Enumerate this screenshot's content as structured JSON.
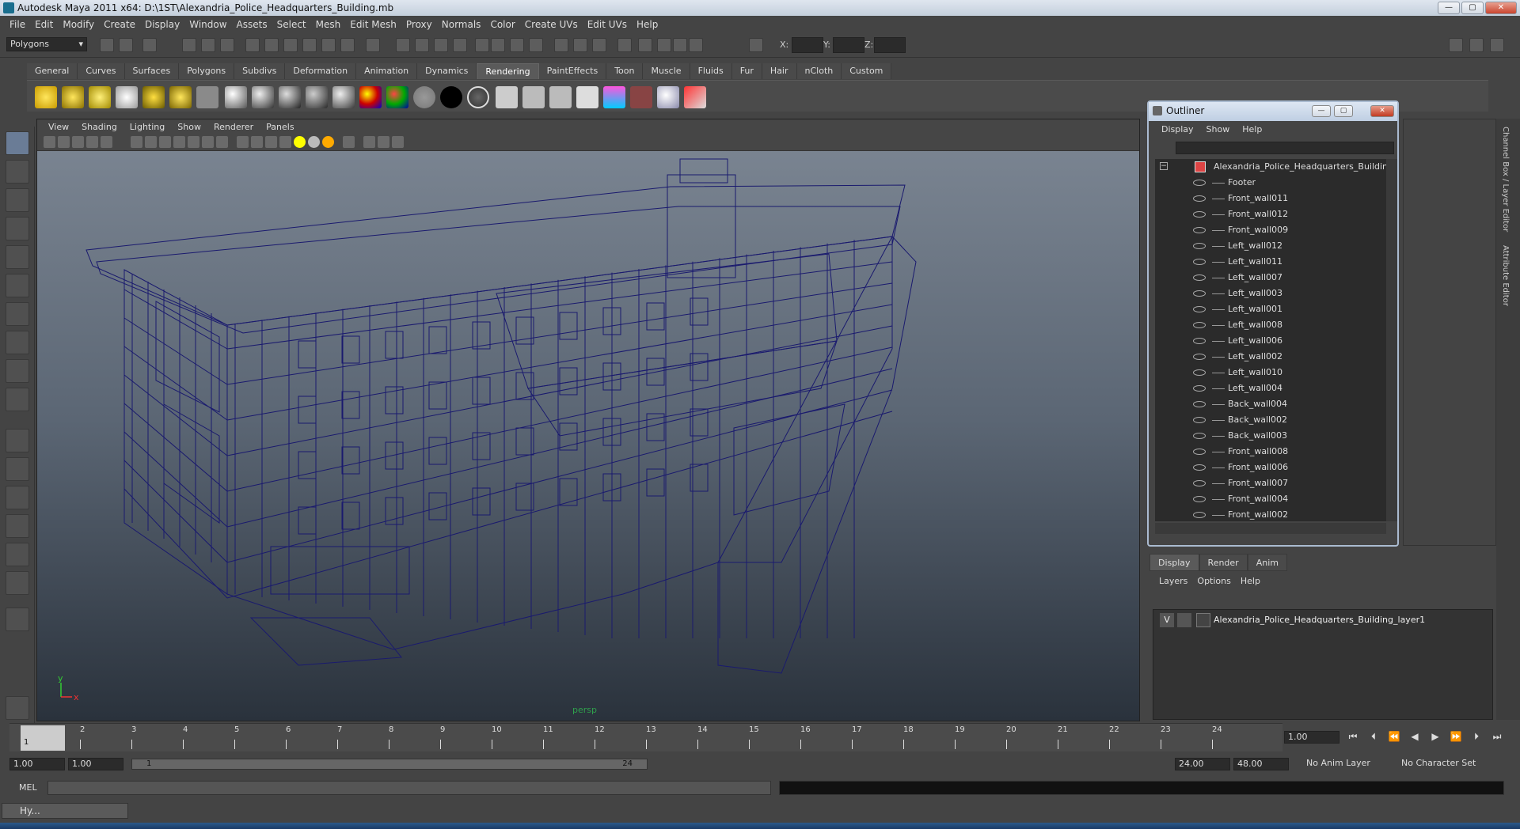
{
  "window": {
    "title": "Autodesk Maya 2011 x64: D:\\1ST\\Alexandria_Police_Headquarters_Building.mb",
    "min": "—",
    "max": "▢",
    "close": "✕"
  },
  "menu": [
    "File",
    "Edit",
    "Modify",
    "Create",
    "Display",
    "Window",
    "Assets",
    "Select",
    "Mesh",
    "Edit Mesh",
    "Proxy",
    "Normals",
    "Color",
    "Create UVs",
    "Edit UVs",
    "Help"
  ],
  "status": {
    "menuset": "Polygons",
    "x_label": "X:",
    "y_label": "Y:",
    "z_label": "Z:"
  },
  "shelf_tabs": [
    "General",
    "Curves",
    "Surfaces",
    "Polygons",
    "Subdivs",
    "Deformation",
    "Animation",
    "Dynamics",
    "Rendering",
    "PaintEffects",
    "Toon",
    "Muscle",
    "Fluids",
    "Fur",
    "Hair",
    "nCloth",
    "Custom"
  ],
  "active_shelf_tab": "Rendering",
  "viewport": {
    "menu": [
      "View",
      "Shading",
      "Lighting",
      "Show",
      "Renderer",
      "Panels"
    ],
    "camera_label": "persp",
    "axis_y": "y",
    "axis_x": "x",
    "wire_color": "#1a1a6e"
  },
  "outliner": {
    "title": "Outliner",
    "menu": [
      "Display",
      "Show",
      "Help"
    ],
    "root": "Alexandria_Police_Headquarters_Building",
    "items": [
      "Footer",
      "Front_wall011",
      "Front_wall012",
      "Front_wall009",
      "Left_wall012",
      "Left_wall011",
      "Left_wall007",
      "Left_wall003",
      "Left_wall001",
      "Left_wall008",
      "Left_wall006",
      "Left_wall002",
      "Left_wall010",
      "Left_wall004",
      "Back_wall004",
      "Back_wall002",
      "Back_wall003",
      "Front_wall008",
      "Front_wall006",
      "Front_wall007",
      "Front_wall004",
      "Front_wall002"
    ]
  },
  "layers": {
    "tabs": [
      "Display",
      "Render",
      "Anim"
    ],
    "active_tab": "Display",
    "menu": [
      "Layers",
      "Options",
      "Help"
    ],
    "layer_visible": "V",
    "layer_name": "Alexandria_Police_Headquarters_Building_layer1"
  },
  "side_tabs": [
    "Channel Box / Layer Editor",
    "Attribute Editor"
  ],
  "timeline": {
    "frames": [
      "1",
      "2",
      "3",
      "4",
      "5",
      "6",
      "7",
      "8",
      "9",
      "10",
      "11",
      "12",
      "13",
      "14",
      "15",
      "16",
      "17",
      "18",
      "19",
      "20",
      "21",
      "22",
      "23",
      "24"
    ],
    "current_frame": "1.00",
    "cursor_frame": "1"
  },
  "range": {
    "start": "1.00",
    "playback_start": "1.00",
    "slider_start": "1",
    "slider_end": "24",
    "playback_end": "24.00",
    "end": "48.00",
    "anim_layer": "No Anim Layer",
    "char_set": "No Character Set"
  },
  "cmdline": {
    "label": "MEL"
  },
  "taskbar": {
    "item": "Hy..."
  }
}
